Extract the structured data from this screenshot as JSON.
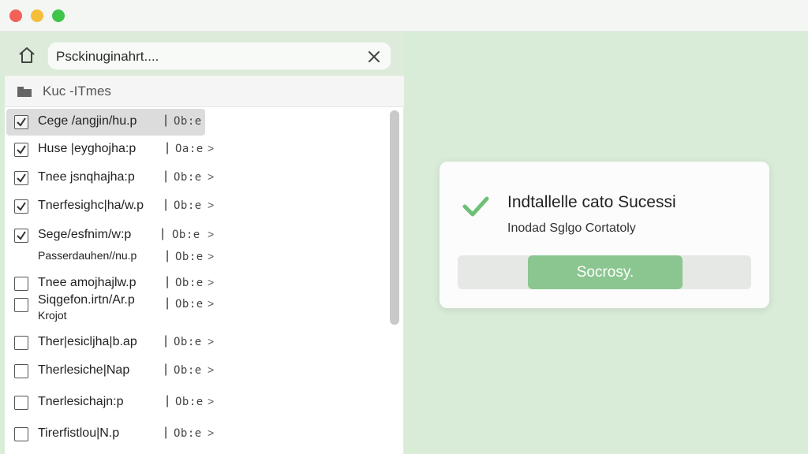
{
  "colors": {
    "background": "#d9ecd8",
    "accent_green": "#8bc690",
    "check_green": "#6fbf76",
    "traffic_red": "#f26158",
    "traffic_yellow": "#f6bd3a",
    "traffic_green": "#3ec54a"
  },
  "window": {
    "controls": [
      "close",
      "minimize",
      "zoom"
    ]
  },
  "toolbar": {
    "home_icon": "home-icon",
    "search_value": "Psckinuginahrt....",
    "clear_icon": "close-icon"
  },
  "panel": {
    "header_icon": "folder-icon",
    "header_title": "Kuc -ITmes",
    "items": [
      {
        "name": "Cege /angjin/hu.p",
        "sep": "|",
        "meta": "Ob:e",
        "checked": true,
        "selected": true,
        "chevron": ""
      },
      {
        "name": "Huse |eyghojha:p",
        "sep": "|",
        "meta": "Oa:e",
        "checked": true,
        "chevron": ">"
      },
      {
        "name": "Tnee jsnqhajha:p",
        "sep": "|",
        "meta": "Ob:e",
        "checked": true,
        "chevron": ">"
      },
      {
        "name": "Tnerfesighc|ha/w.p",
        "sep": "|",
        "meta": "Ob:e",
        "checked": true,
        "chevron": ">"
      },
      {
        "name": "Sege/esfnim/w:p",
        "sep": "|",
        "meta": "Ob:e",
        "checked": true,
        "chevron": ">"
      },
      {
        "name": "Passerdauhen//nu.p",
        "sep": "|",
        "meta": "Ob:e",
        "checked": false,
        "nobox": true,
        "chevron": ">"
      },
      {
        "name": "Tnee amojhajlw.p",
        "sep": "|",
        "meta": "Ob:e",
        "checked": false,
        "chevron": ">"
      },
      {
        "name": "Siqgefon.irtn/Ar.p",
        "name2": "Krojot",
        "sep": "|",
        "meta": "Ob:e",
        "checked": false,
        "chevron": ">"
      },
      {
        "name": "Ther|esicljha|b.ap",
        "sep": "|",
        "meta": "Ob:e",
        "checked": false,
        "chevron": ">"
      },
      {
        "name": "Therlesiche|Nap",
        "sep": "|",
        "meta": "Ob:e",
        "checked": false,
        "chevron": ">"
      },
      {
        "name": "Tnerlesichajn:p",
        "sep": "|",
        "meta": "Ob:e",
        "checked": false,
        "chevron": ">"
      },
      {
        "name": "Tirerfistlou|N.p",
        "sep": "|",
        "meta": "Ob:e",
        "checked": false,
        "chevron": ">"
      }
    ]
  },
  "dialog": {
    "icon": "checkmark-icon",
    "title": "Indtallelle cato Sucessi",
    "subtitle": "Inodad Sglgo Cortatoly",
    "button_label": "Socrosy."
  }
}
